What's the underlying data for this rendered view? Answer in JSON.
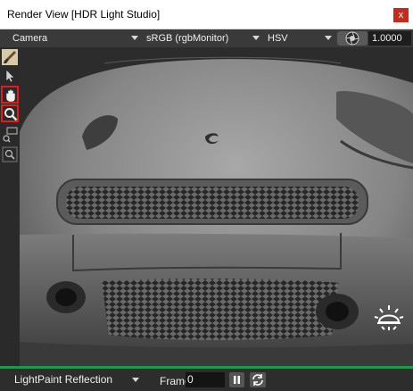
{
  "window": {
    "title": "Render View [HDR Light Studio]",
    "close_label": "x"
  },
  "toolbar": {
    "camera": "Camera",
    "color_space": "sRGB (rgbMonitor)",
    "color_model": "HSV",
    "exposure": "1.0000"
  },
  "tools": [
    {
      "icon": "paintbrush-icon",
      "active": false
    },
    {
      "icon": "pointer-arrow-icon",
      "active": false
    },
    {
      "icon": "hand-icon",
      "active": true
    },
    {
      "icon": "magnifier-icon",
      "active": true
    },
    {
      "icon": "region-zoom-icon",
      "active": false
    },
    {
      "icon": "zoom-fit-icon",
      "active": false
    }
  ],
  "viewport": {
    "content": "car-front-render",
    "overlay_icon": "light-bulb-icon"
  },
  "bottom": {
    "mode": "LightPaint Reflection",
    "frame_label": "Frame",
    "frame_value": "0"
  },
  "colors": {
    "close": "#c42b1c",
    "active_tool": "#e21b1b",
    "status": "#1f9a3f"
  }
}
